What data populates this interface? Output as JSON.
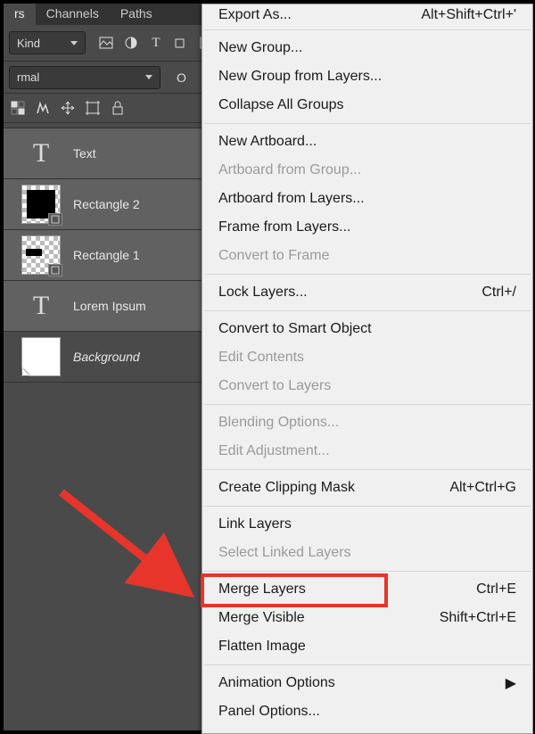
{
  "tabs": {
    "layers": "rs",
    "channels": "Channels",
    "paths": "Paths"
  },
  "filter": {
    "kind": "Kind",
    "icons": [
      "image-filter",
      "adjust-filter",
      "text-filter",
      "shape-filter",
      "smart-filter"
    ]
  },
  "blend": {
    "mode": "rmal",
    "opacity_label": "O"
  },
  "tool_icons": [
    "lock-transparency-icon",
    "lock-image-icon",
    "lock-position-icon",
    "lock-artboard-icon",
    "lock-all-icon"
  ],
  "layers": [
    {
      "name": "Text",
      "type": "text",
      "italic": false
    },
    {
      "name": "Rectangle 2",
      "type": "shape-full",
      "italic": false
    },
    {
      "name": "Rectangle 1",
      "type": "shape-small",
      "italic": false
    },
    {
      "name": "Lorem Ipsum",
      "type": "text",
      "italic": false
    },
    {
      "name": "Background",
      "type": "white",
      "italic": true
    }
  ],
  "menu": [
    {
      "label": "Export As...",
      "shortcut": "Alt+Shift+Ctrl+'",
      "enabled": true
    },
    {
      "sep": true
    },
    {
      "label": "New Group...",
      "shortcut": "",
      "enabled": true
    },
    {
      "label": "New Group from Layers...",
      "shortcut": "",
      "enabled": true
    },
    {
      "label": "Collapse All Groups",
      "shortcut": "",
      "enabled": true
    },
    {
      "sep": true
    },
    {
      "label": "New Artboard...",
      "shortcut": "",
      "enabled": true
    },
    {
      "label": "Artboard from Group...",
      "shortcut": "",
      "enabled": false
    },
    {
      "label": "Artboard from Layers...",
      "shortcut": "",
      "enabled": true
    },
    {
      "label": "Frame from Layers...",
      "shortcut": "",
      "enabled": true
    },
    {
      "label": "Convert to Frame",
      "shortcut": "",
      "enabled": false
    },
    {
      "sep": true
    },
    {
      "label": "Lock Layers...",
      "shortcut": "Ctrl+/",
      "enabled": true
    },
    {
      "sep": true
    },
    {
      "label": "Convert to Smart Object",
      "shortcut": "",
      "enabled": true
    },
    {
      "label": "Edit Contents",
      "shortcut": "",
      "enabled": false
    },
    {
      "label": "Convert to Layers",
      "shortcut": "",
      "enabled": false
    },
    {
      "sep": true
    },
    {
      "label": "Blending Options...",
      "shortcut": "",
      "enabled": false
    },
    {
      "label": "Edit Adjustment...",
      "shortcut": "",
      "enabled": false
    },
    {
      "sep": true
    },
    {
      "label": "Create Clipping Mask",
      "shortcut": "Alt+Ctrl+G",
      "enabled": true
    },
    {
      "sep": true
    },
    {
      "label": "Link Layers",
      "shortcut": "",
      "enabled": true
    },
    {
      "label": "Select Linked Layers",
      "shortcut": "",
      "enabled": false
    },
    {
      "sep": true
    },
    {
      "label": "Merge Layers",
      "shortcut": "Ctrl+E",
      "enabled": true,
      "highlight": true
    },
    {
      "label": "Merge Visible",
      "shortcut": "Shift+Ctrl+E",
      "enabled": true
    },
    {
      "label": "Flatten Image",
      "shortcut": "",
      "enabled": true
    },
    {
      "sep": true
    },
    {
      "label": "Animation Options",
      "shortcut": "▶",
      "enabled": true
    },
    {
      "label": "Panel Options...",
      "shortcut": "",
      "enabled": true
    }
  ]
}
